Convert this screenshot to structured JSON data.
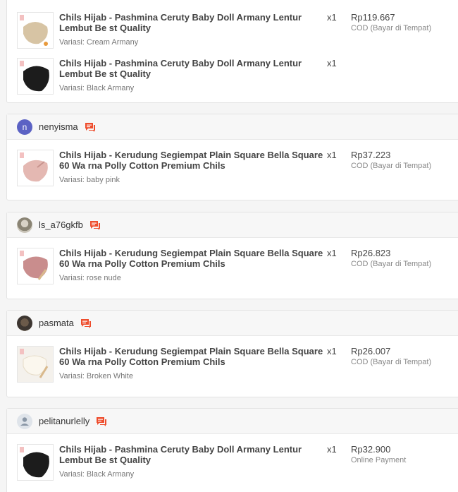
{
  "orders": [
    {
      "username": "",
      "items": [
        {
          "name": "Chils Hijab - Pashmina Ceruty Baby Doll Armany Lentur Lembut Be st Quality",
          "qty": "x1",
          "variant": "Variasi: Cream Armany",
          "price": "Rp119.667",
          "payment": "COD (Bayar di Tempat)",
          "thumb_color": "#d7c4a4"
        },
        {
          "name": "Chils Hijab - Pashmina Ceruty Baby Doll Armany Lentur Lembut Be st Quality",
          "qty": "x1",
          "variant": "Variasi: Black Armany",
          "price": "",
          "payment": "",
          "thumb_color": "#1c1c1c"
        }
      ]
    },
    {
      "username": "nenyisma",
      "avatar_letter": "n",
      "items": [
        {
          "name": "Chils Hijab - Kerudung Segiempat Plain Square Bella Square 60 Wa rna Polly Cotton Premium Chils",
          "qty": "x1",
          "variant": "Variasi: baby pink",
          "price": "Rp37.223",
          "payment": "COD (Bayar di Tempat)",
          "thumb_color": "#e4b8b2"
        }
      ]
    },
    {
      "username": "ls_a76gkfb",
      "items": [
        {
          "name": "Chils Hijab - Kerudung Segiempat Plain Square Bella Square 60 Wa rna Polly Cotton Premium Chils",
          "qty": "x1",
          "variant": "Variasi: rose nude",
          "price": "Rp26.823",
          "payment": "COD (Bayar di Tempat)",
          "thumb_color": "#c98d8d"
        }
      ]
    },
    {
      "username": "pasmata",
      "items": [
        {
          "name": "Chils Hijab - Kerudung Segiempat Plain Square Bella Square 60 Wa rna Polly Cotton Premium Chils",
          "qty": "x1",
          "variant": "Variasi: Broken White",
          "price": "Rp26.007",
          "payment": "COD (Bayar di Tempat)",
          "thumb_color": "#f1ead9"
        }
      ]
    },
    {
      "username": "pelitanurlelly",
      "items": [
        {
          "name": "Chils Hijab - Pashmina Ceruty Baby Doll Armany Lentur Lembut Be st Quality",
          "qty": "x1",
          "variant": "Variasi: Black Armany",
          "price": "Rp32.900",
          "payment": "Online Payment",
          "thumb_color": "#1c1c1c"
        }
      ]
    }
  ],
  "icons": {
    "chat": "chat-icon",
    "avatar_default": "user-silhouette-icon"
  },
  "colors": {
    "chat_icon": "#ee4d2d",
    "avatar_letter_bg": "#5b62c4"
  }
}
